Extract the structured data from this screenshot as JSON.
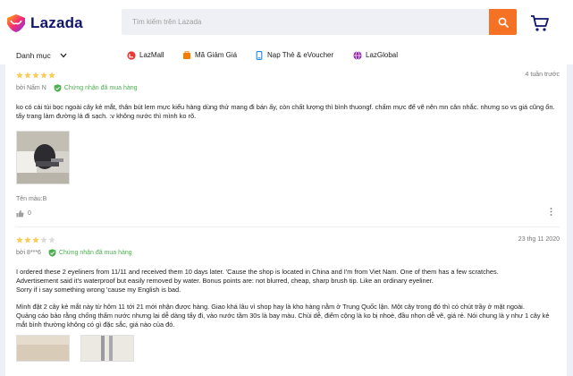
{
  "brand": {
    "name": "Lazada",
    "accent": "#f57224",
    "logo_text_color": "#0f146d"
  },
  "search": {
    "placeholder": "Tìm kiếm trên Lazada",
    "icon": "search-icon"
  },
  "header": {
    "cart_icon": "cart-icon"
  },
  "nav": {
    "category_label": "Danh mục",
    "links": [
      {
        "label": "LazMall",
        "icon": "lazmall-icon",
        "color": "#e53935"
      },
      {
        "label": "Mã Giảm Giá",
        "icon": "voucher-icon",
        "color": "#f57c00"
      },
      {
        "label": "Nạp Thẻ & eVoucher",
        "icon": "topup-icon",
        "color": "#1e88e5"
      },
      {
        "label": "LazGlobal",
        "icon": "lazglobal-icon",
        "color": "#8e24aa"
      }
    ]
  },
  "reviews": [
    {
      "rating": 5,
      "date": "4 tuần trước",
      "author": "bởi Nấm N",
      "verified_label": "Chứng nhận đã mua hàng",
      "content": [
        "ko có cái túi bọc ngoài cây kẻ mắt, thân bút lem mực kiểu hàng dùng thử mang đi bán ấy, còn chất lượng thì bình thuongf. chấm mực để vẽ nên mn cân nhắc. nhưng so vs giá cũng ổn. tẩy trang làm đường là đi sạch. :v không nước thì mình ko rõ."
      ],
      "variant": "Tên màu:B",
      "likes": "0"
    },
    {
      "rating": 3,
      "date": "23 thg 11 2020",
      "author": "bởi 8***6",
      "verified_label": "Chứng nhận đã mua hàng",
      "content": [
        "I ordered these 2 eyeliners from 11/11 and received them 10 days later. 'Cause the shop is located in China and I'm from Viet Nam. One of them has a few scratches.",
        "Advertisement said it's waterproof but easily removed by water. Bonus points are: not blurred, cheap, sharp brush tip. Like an ordinary eyeliner.",
        "Sorry if i say something wrong 'cause my English is bad."
      ],
      "content_vi": [
        "Mình đặt 2 cây kẻ mắt này từ hôm 11 tới 21 mới nhận được hàng. Giao khá lâu vì shop hay là kho hàng nằm ở Trung Quốc lận. Một cây trong đó thì có chút trầy ở mặt ngoài.",
        "Quảng cáo bảo rằng chống thấm nước nhưng lại dễ dàng tẩy đi, vào nước tầm 30s là bay màu. Chùi dễ, điểm cộng là ko bị nhoè, đầu nhọn dễ vẽ, giá rẻ. Nói chung là y như 1 cây kẻ mắt bình thường không có gì đặc sắc, giá nào của đó."
      ]
    }
  ],
  "colors": {
    "star": "#faca51",
    "star_empty": "#dadada",
    "verified": "#4caf50"
  }
}
